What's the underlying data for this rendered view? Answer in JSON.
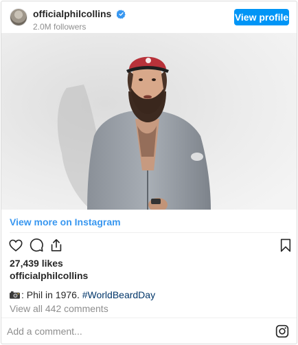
{
  "header": {
    "username": "officialphilcollins",
    "followers": "2.0M followers",
    "view_profile_label": "View profile",
    "verified_color": "#3897f0",
    "avatar_icon": "profile-avatar"
  },
  "post": {
    "image_icon": "photo",
    "view_more_label": "View more on Instagram",
    "likes": "27,439 likes",
    "owner": "officialphilcollins",
    "caption_icon": "camera-icon",
    "caption_text": ": Phil in 1976. ",
    "hashtag": "#WorldBeardDay",
    "comments_label": "View all 442 comments",
    "icons": [
      "heart-icon",
      "comment-icon",
      "share-icon",
      "bookmark-icon"
    ]
  },
  "comment_box": {
    "placeholder": "Add a comment...",
    "value": "",
    "icon": "instagram-icon"
  },
  "colors": {
    "accent": "#0095f6",
    "link": "#3897f0",
    "hashtag": "#003569",
    "muted": "#8e8e8e"
  }
}
